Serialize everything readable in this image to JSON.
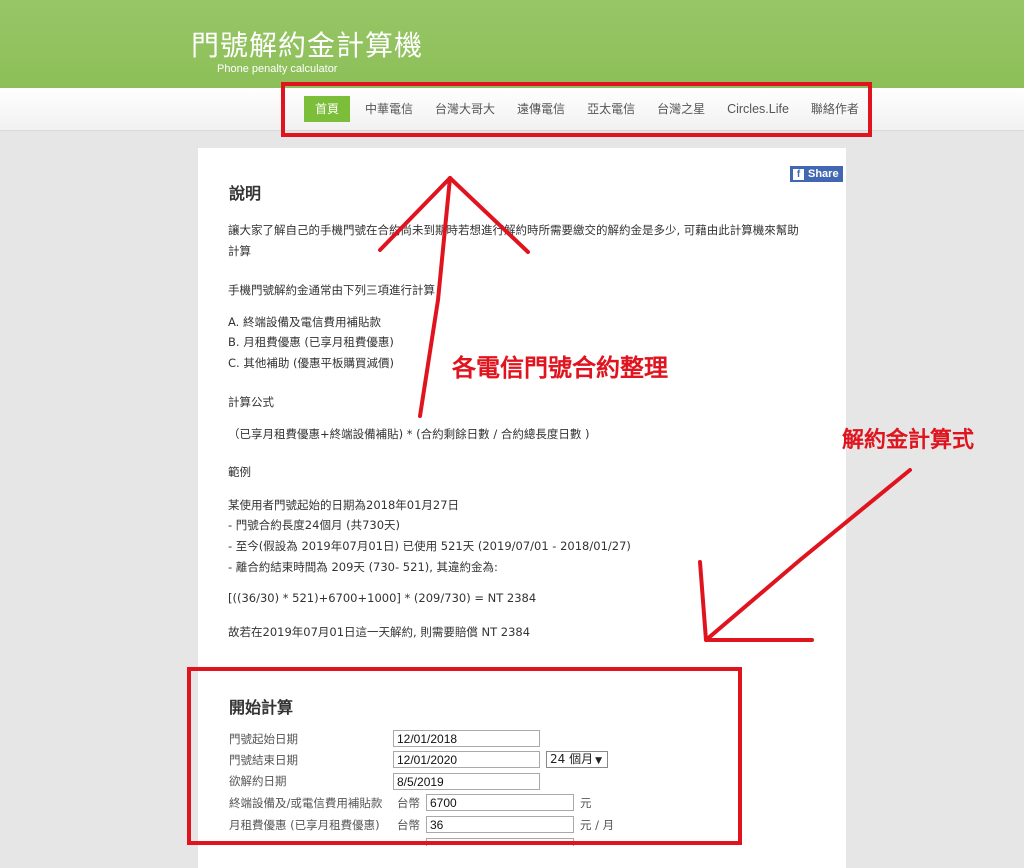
{
  "site": {
    "title": "門號解約金計算機",
    "subtitle": "Phone penalty calculator"
  },
  "nav": {
    "items": [
      "首頁",
      "中華電信",
      "台灣大哥大",
      "遠傳電信",
      "亞太電信",
      "台灣之星",
      "Circles.Life",
      "聯絡作者"
    ],
    "active": "首頁"
  },
  "share": {
    "label": "Share"
  },
  "intro": {
    "heading": "說明",
    "para1_line1": "讓大家了解自己的手機門號在合約尚未到期時若想進行解約時所需要繳交的解約金是多少, 可藉由此計算機來幫助",
    "para1_line2": "計算",
    "para2": "手機門號解約金通常由下列三項進行計算",
    "item_a": "A. 終端設備及電信費用補貼款",
    "item_b": "B. 月租費優惠 (已享月租費優惠)",
    "item_c": "C. 其他補助 (優惠平板購買減價)",
    "formula_title": "計算公式",
    "formula": "（已享月租費優惠+終端設備補貼) * (合約剩餘日數 / 合約總長度日數 )",
    "example_title": "範例",
    "ex1": "某使用者門號起始的日期為2018年01月27日",
    "ex2": "- 門號合約長度24個月 (共730天)",
    "ex3": "- 至今(假設為 2019年07月01日) 已使用 521天 (2019/07/01 - 2018/01/27)",
    "ex4": "- 離合約結束時間為 209天 (730- 521), 其違約金為:",
    "ex_formula": "[((36/30) * 521)+6700+1000] * (209/730) = NT 2384",
    "ex_result": "故若在2019年07月01日這一天解約, 則需要賠償 NT 2384"
  },
  "calc": {
    "heading": "開始計算",
    "start_label": "門號起始日期",
    "start_value": "12/01/2018",
    "end_label": "門號結束日期",
    "end_value": "12/01/2020",
    "length_select": "24 個月",
    "cancel_label": "欲解約日期",
    "cancel_value": "8/5/2019",
    "device_label": "終端設備及/或電信費用補貼款",
    "device_currency": "台幣",
    "device_value": "6700",
    "device_unit": "元",
    "rent_label": "月租費優惠 (已享月租費優惠)",
    "rent_currency": "台幣",
    "rent_value": "36",
    "rent_unit": "元 / 月"
  },
  "annotations": {
    "carrier_note": "各電信門號合約整理",
    "formula_note": "解約金計算式"
  },
  "colors": {
    "header_green": "#8cbf58",
    "nav_active": "#7cbd3a",
    "annotation_red": "#e0141e",
    "share_blue": "#4267b2"
  }
}
